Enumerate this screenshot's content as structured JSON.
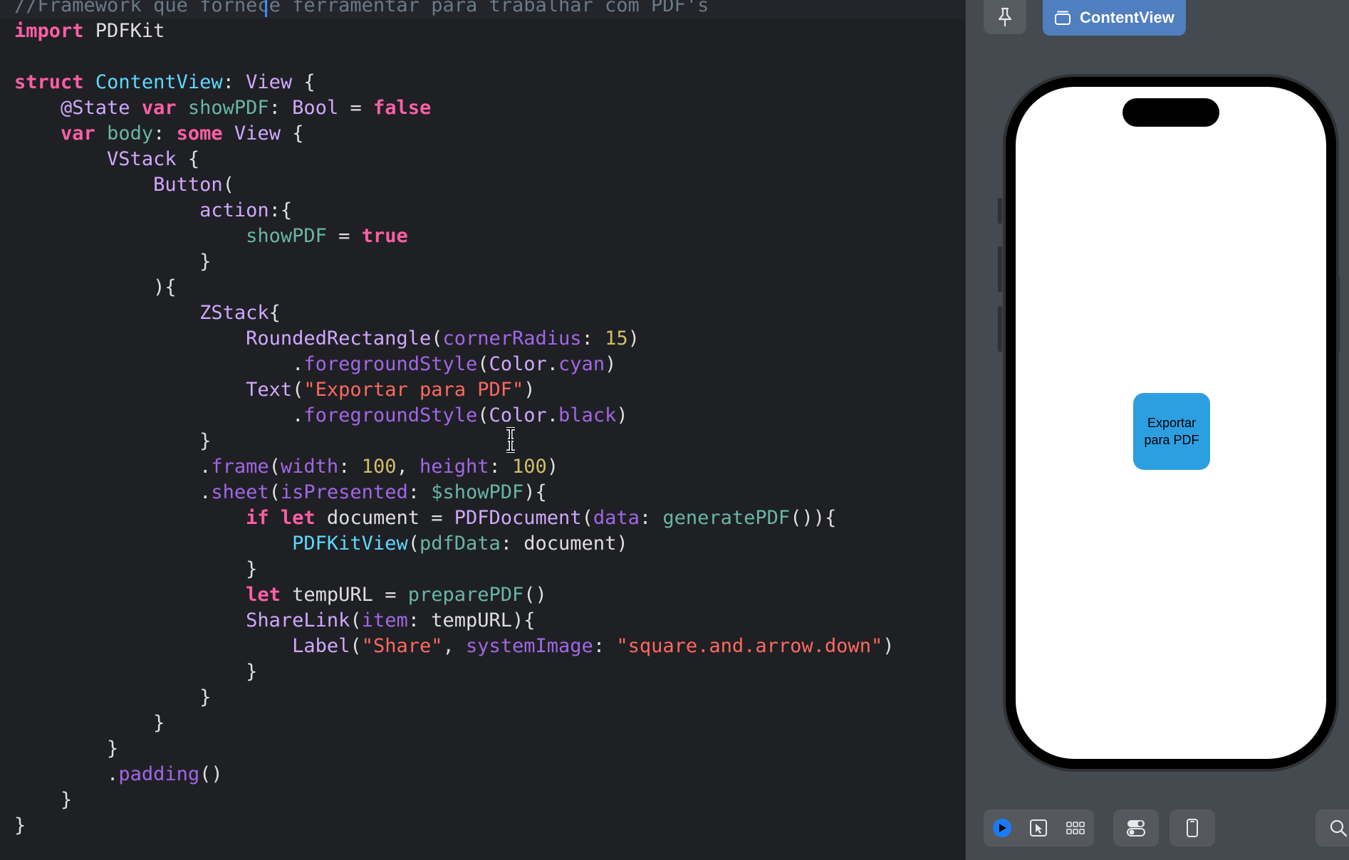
{
  "editor": {
    "lines": [
      [
        {
          "t": "//Framework que fornece ferramentar para trabalhar com PDF's",
          "c": "com"
        }
      ],
      [
        {
          "t": "import",
          "c": "kw"
        },
        {
          "t": " PDFKit",
          "c": "plain"
        }
      ],
      [],
      [
        {
          "t": "struct",
          "c": "kw"
        },
        {
          "t": " ",
          "c": "plain"
        },
        {
          "t": "ContentView",
          "c": "decl"
        },
        {
          "t": ": ",
          "c": "plain"
        },
        {
          "t": "View",
          "c": "type"
        },
        {
          "t": " {",
          "c": "plain"
        }
      ],
      [
        {
          "t": "    @State ",
          "c": "type"
        },
        {
          "t": "var",
          "c": "kw"
        },
        {
          "t": " ",
          "c": "plain"
        },
        {
          "t": "showPDF",
          "c": "var"
        },
        {
          "t": ": ",
          "c": "plain"
        },
        {
          "t": "Bool",
          "c": "type"
        },
        {
          "t": " = ",
          "c": "plain"
        },
        {
          "t": "false",
          "c": "kw"
        }
      ],
      [
        {
          "t": "    ",
          "c": "plain"
        },
        {
          "t": "var",
          "c": "kw"
        },
        {
          "t": " ",
          "c": "plain"
        },
        {
          "t": "body",
          "c": "var"
        },
        {
          "t": ": ",
          "c": "plain"
        },
        {
          "t": "some",
          "c": "kw"
        },
        {
          "t": " ",
          "c": "plain"
        },
        {
          "t": "View",
          "c": "type"
        },
        {
          "t": " {",
          "c": "plain"
        }
      ],
      [
        {
          "t": "        ",
          "c": "plain"
        },
        {
          "t": "VStack",
          "c": "type"
        },
        {
          "t": " {",
          "c": "plain"
        }
      ],
      [
        {
          "t": "            ",
          "c": "plain"
        },
        {
          "t": "Button",
          "c": "type"
        },
        {
          "t": "(",
          "c": "plain"
        }
      ],
      [
        {
          "t": "                ",
          "c": "plain"
        },
        {
          "t": "action",
          "c": "type"
        },
        {
          "t": ":{",
          "c": "plain"
        }
      ],
      [
        {
          "t": "                    ",
          "c": "plain"
        },
        {
          "t": "showPDF",
          "c": "var"
        },
        {
          "t": " = ",
          "c": "plain"
        },
        {
          "t": "true",
          "c": "kw"
        }
      ],
      [
        {
          "t": "                }",
          "c": "plain"
        }
      ],
      [
        {
          "t": "            ){",
          "c": "plain"
        }
      ],
      [
        {
          "t": "                ",
          "c": "plain"
        },
        {
          "t": "ZStack",
          "c": "type"
        },
        {
          "t": "{",
          "c": "plain"
        }
      ],
      [
        {
          "t": "                    ",
          "c": "plain"
        },
        {
          "t": "RoundedRectangle",
          "c": "type"
        },
        {
          "t": "(",
          "c": "plain"
        },
        {
          "t": "cornerRadius",
          "c": "prop"
        },
        {
          "t": ": ",
          "c": "plain"
        },
        {
          "t": "15",
          "c": "num"
        },
        {
          "t": ")",
          "c": "plain"
        }
      ],
      [
        {
          "t": "                        .",
          "c": "plain"
        },
        {
          "t": "foregroundStyle",
          "c": "prop"
        },
        {
          "t": "(",
          "c": "plain"
        },
        {
          "t": "Color",
          "c": "type"
        },
        {
          "t": ".",
          "c": "plain"
        },
        {
          "t": "cyan",
          "c": "prop"
        },
        {
          "t": ")",
          "c": "plain"
        }
      ],
      [
        {
          "t": "                    ",
          "c": "plain"
        },
        {
          "t": "Text",
          "c": "type"
        },
        {
          "t": "(",
          "c": "plain"
        },
        {
          "t": "\"Exportar para PDF\"",
          "c": "str"
        },
        {
          "t": ")",
          "c": "plain"
        }
      ],
      [
        {
          "t": "                        .",
          "c": "plain"
        },
        {
          "t": "foregroundStyle",
          "c": "prop"
        },
        {
          "t": "(",
          "c": "plain"
        },
        {
          "t": "Color",
          "c": "type"
        },
        {
          "t": ".",
          "c": "plain"
        },
        {
          "t": "black",
          "c": "prop"
        },
        {
          "t": ")",
          "c": "plain"
        }
      ],
      [
        {
          "t": "                }",
          "c": "plain"
        }
      ],
      [
        {
          "t": "                .",
          "c": "plain"
        },
        {
          "t": "frame",
          "c": "prop"
        },
        {
          "t": "(",
          "c": "plain"
        },
        {
          "t": "width",
          "c": "prop"
        },
        {
          "t": ": ",
          "c": "plain"
        },
        {
          "t": "100",
          "c": "num"
        },
        {
          "t": ", ",
          "c": "plain"
        },
        {
          "t": "height",
          "c": "prop"
        },
        {
          "t": ": ",
          "c": "plain"
        },
        {
          "t": "100",
          "c": "num"
        },
        {
          "t": ")",
          "c": "plain"
        }
      ],
      [
        {
          "t": "                .",
          "c": "plain"
        },
        {
          "t": "sheet",
          "c": "prop"
        },
        {
          "t": "(",
          "c": "plain"
        },
        {
          "t": "isPresented",
          "c": "prop"
        },
        {
          "t": ": ",
          "c": "plain"
        },
        {
          "t": "$showPDF",
          "c": "var"
        },
        {
          "t": "){",
          "c": "plain"
        }
      ],
      [
        {
          "t": "                    ",
          "c": "plain"
        },
        {
          "t": "if",
          "c": "kw"
        },
        {
          "t": " ",
          "c": "plain"
        },
        {
          "t": "let",
          "c": "kw"
        },
        {
          "t": " document = ",
          "c": "plain"
        },
        {
          "t": "PDFDocument",
          "c": "type"
        },
        {
          "t": "(",
          "c": "plain"
        },
        {
          "t": "data",
          "c": "prop"
        },
        {
          "t": ": ",
          "c": "plain"
        },
        {
          "t": "generatePDF",
          "c": "var"
        },
        {
          "t": "()){",
          "c": "plain"
        }
      ],
      [
        {
          "t": "                        ",
          "c": "plain"
        },
        {
          "t": "PDFKitView",
          "c": "decl"
        },
        {
          "t": "(",
          "c": "plain"
        },
        {
          "t": "pdfData",
          "c": "var"
        },
        {
          "t": ": document)",
          "c": "plain"
        }
      ],
      [
        {
          "t": "                    }",
          "c": "plain"
        }
      ],
      [
        {
          "t": "                    ",
          "c": "plain"
        },
        {
          "t": "let",
          "c": "kw"
        },
        {
          "t": " tempURL = ",
          "c": "plain"
        },
        {
          "t": "preparePDF",
          "c": "var"
        },
        {
          "t": "()",
          "c": "plain"
        }
      ],
      [
        {
          "t": "                    ",
          "c": "plain"
        },
        {
          "t": "ShareLink",
          "c": "type"
        },
        {
          "t": "(",
          "c": "plain"
        },
        {
          "t": "item",
          "c": "prop"
        },
        {
          "t": ": tempURL){",
          "c": "plain"
        }
      ],
      [
        {
          "t": "                        ",
          "c": "plain"
        },
        {
          "t": "Label",
          "c": "type"
        },
        {
          "t": "(",
          "c": "plain"
        },
        {
          "t": "\"Share\"",
          "c": "str"
        },
        {
          "t": ", ",
          "c": "plain"
        },
        {
          "t": "systemImage",
          "c": "prop"
        },
        {
          "t": ": ",
          "c": "plain"
        },
        {
          "t": "\"square.and.arrow.down\"",
          "c": "str"
        },
        {
          "t": ")",
          "c": "plain"
        }
      ],
      [
        {
          "t": "                    }",
          "c": "plain"
        }
      ],
      [
        {
          "t": "                }",
          "c": "plain"
        }
      ],
      [
        {
          "t": "            }",
          "c": "plain"
        }
      ],
      [
        {
          "t": "        }",
          "c": "plain"
        }
      ],
      [
        {
          "t": "        .",
          "c": "plain"
        },
        {
          "t": "padding",
          "c": "prop"
        },
        {
          "t": "()",
          "c": "plain"
        }
      ],
      [
        {
          "t": "    }",
          "c": "plain"
        }
      ],
      [
        {
          "t": "}",
          "c": "plain"
        }
      ]
    ]
  },
  "preview": {
    "tab_label": "ContentView",
    "button_label": "Exportar para PDF",
    "button_color": "#2c9fe0",
    "accent_color": "#4f7fbf"
  },
  "toolbar": {
    "items": [
      "live-mode-icon",
      "selectable-mode-icon",
      "variants-icon",
      "device-settings-icon",
      "device-icon",
      "zoom-icon"
    ]
  }
}
